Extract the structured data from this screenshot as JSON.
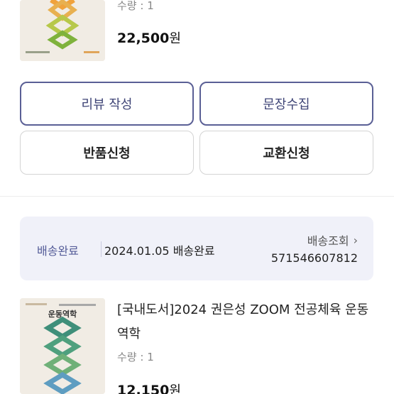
{
  "item1": {
    "cover_small": "",
    "quantity": "수량 : 1",
    "price": "22,500",
    "currency": "원"
  },
  "buttons": {
    "write_review": "리뷰 작성",
    "collect_sentences": "문장수집",
    "request_return": "반품신청",
    "request_exchange": "교환신청"
  },
  "shipment": {
    "status": "배송완료",
    "detail": "2024.01.05 배송완료",
    "track_label": "배송조회",
    "tracking_number": "571546607812"
  },
  "item2": {
    "cover_title": "운동역학",
    "title": "[국내도서]2024 권은성 ZOOM 전공체육 운동역학",
    "quantity": "수량 : 1",
    "price": "12,150",
    "currency": "원"
  },
  "colors": {
    "accent": "#545c98",
    "status_bg": "#f0f1f9",
    "cover_bg": "#f1ece4"
  },
  "icons": {
    "chevron": "chevron-right-icon"
  }
}
